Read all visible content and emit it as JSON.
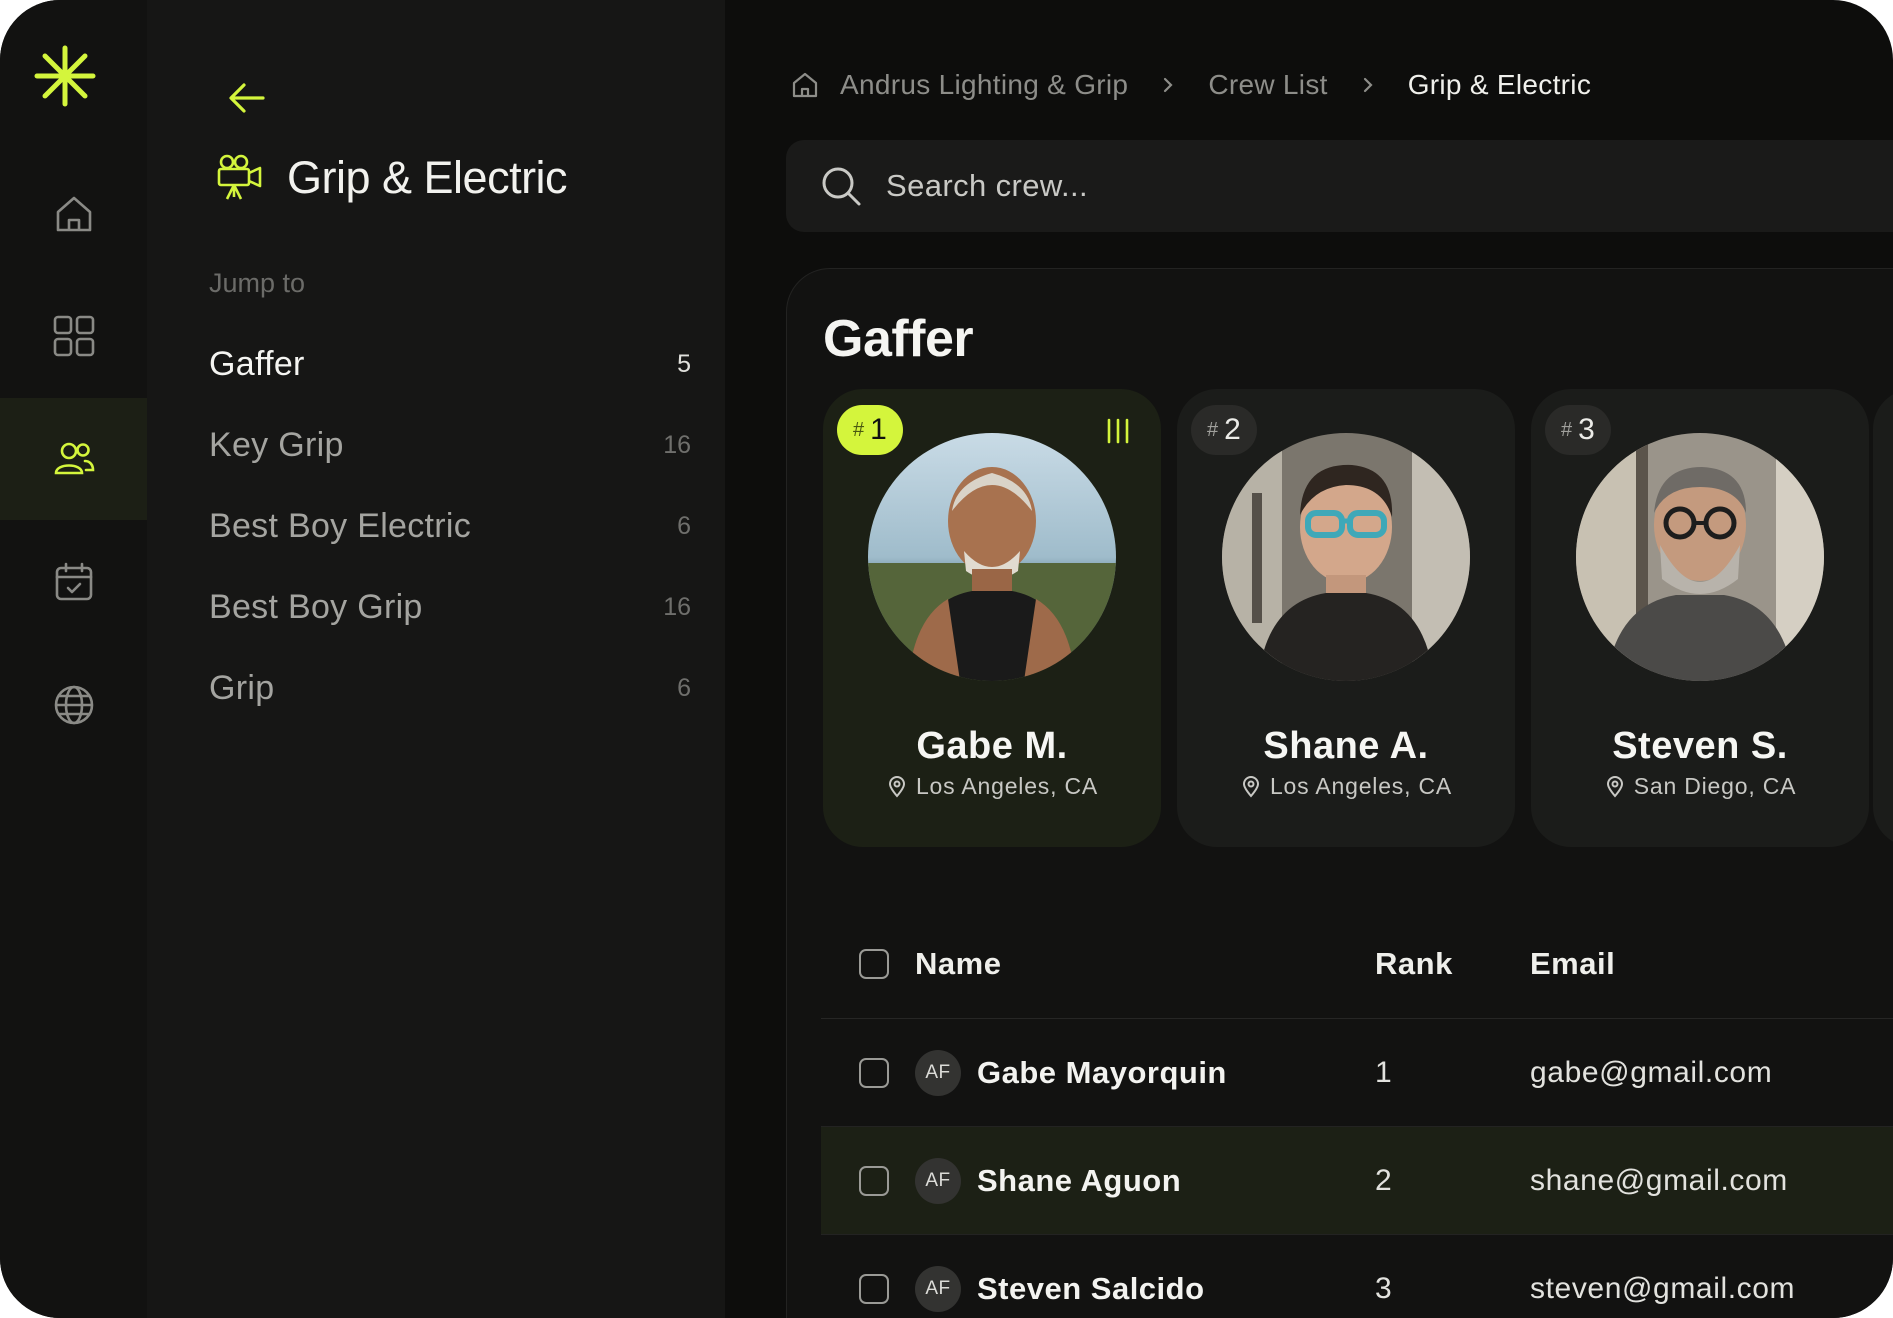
{
  "colors": {
    "accent": "#d4f53c",
    "background": "#0d0d0c",
    "panel": "#161615"
  },
  "rail": {
    "items": [
      {
        "icon": "home-icon"
      },
      {
        "icon": "grid-icon"
      },
      {
        "icon": "users-icon",
        "active": true
      },
      {
        "icon": "calendar-check-icon"
      },
      {
        "icon": "globe-icon"
      }
    ]
  },
  "panel": {
    "title": "Grip & Electric",
    "jump_label": "Jump to",
    "items": [
      {
        "label": "Gaffer",
        "count": "5"
      },
      {
        "label": "Key Grip",
        "count": "16"
      },
      {
        "label": "Best Boy Electric",
        "count": "6"
      },
      {
        "label": "Best Boy Grip",
        "count": "16"
      },
      {
        "label": "Grip",
        "count": "6"
      }
    ]
  },
  "breadcrumb": [
    "Andrus Lighting & Grip",
    "Crew List",
    "Grip & Electric"
  ],
  "search": {
    "placeholder": "Search crew..."
  },
  "section": {
    "title": "Gaffer",
    "cards": [
      {
        "hash": "#",
        "rank": "1",
        "name": "Gabe M.",
        "location": "Los Angeles, CA"
      },
      {
        "hash": "#",
        "rank": "2",
        "name": "Shane A.",
        "location": "Los Angeles, CA"
      },
      {
        "hash": "#",
        "rank": "3",
        "name": "Steven S.",
        "location": "San Diego, CA"
      }
    ]
  },
  "table": {
    "headers": {
      "name": "Name",
      "rank": "Rank",
      "email": "Email"
    },
    "rows": [
      {
        "initials": "AF",
        "name": "Gabe Mayorquin",
        "rank": "1",
        "email": "gabe@gmail.com"
      },
      {
        "initials": "AF",
        "name": "Shane Aguon",
        "rank": "2",
        "email": "shane@gmail.com"
      },
      {
        "initials": "AF",
        "name": "Steven Salcido",
        "rank": "3",
        "email": "steven@gmail.com"
      }
    ]
  }
}
